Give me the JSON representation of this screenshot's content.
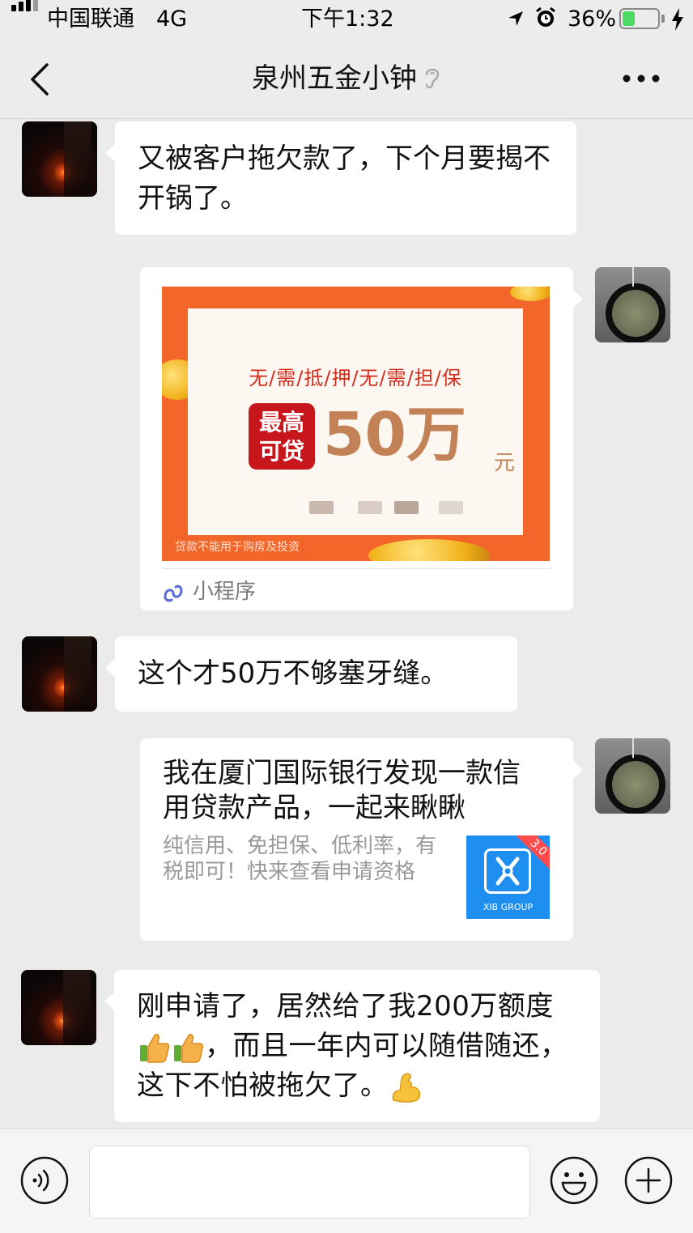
{
  "status_bar": {
    "carrier": "中国联通",
    "network": "4G",
    "time": "下午1:32",
    "battery_percent": "36%",
    "battery_level": 0.36
  },
  "nav": {
    "title": "泉州五金小钟"
  },
  "messages": [
    {
      "side": "left",
      "text": "又被客户拖欠款了，下个月要揭不开锅了。"
    },
    {
      "side": "right",
      "type": "mini-program",
      "banner": {
        "headline": "无/需/抵/押/无/需/担/保",
        "badge": "最高可贷",
        "amount": "50万",
        "unit": "元",
        "note": "贷款不能用于购房及投资"
      },
      "label": "小程序"
    },
    {
      "side": "left",
      "text": "这个才50万不够塞牙缝。"
    },
    {
      "side": "right",
      "type": "link",
      "title": "我在厦门国际银行发现一款信用贷款产品，一起来瞅瞅",
      "description": "纯信用、免担保、低利率，有税即可！快来查看申请资格",
      "thumb_ribbon": "3.0",
      "thumb_logo_text": "XIB GROUP"
    },
    {
      "side": "left",
      "text_part1": "刚申请了，居然给了我200万额度",
      "text_part2": "，而且一年内可以随借随还，这下不怕被拖欠了。",
      "emojis": [
        "thumbs-up",
        "thumbs-up",
        "flexed-biceps"
      ]
    }
  ],
  "colors": {
    "chat_background": "#ebebeb",
    "bubble": "#ffffff",
    "banner_orange": "#f2662a",
    "badge_red": "#c8161d",
    "xib_blue": "#1e8ef0"
  }
}
